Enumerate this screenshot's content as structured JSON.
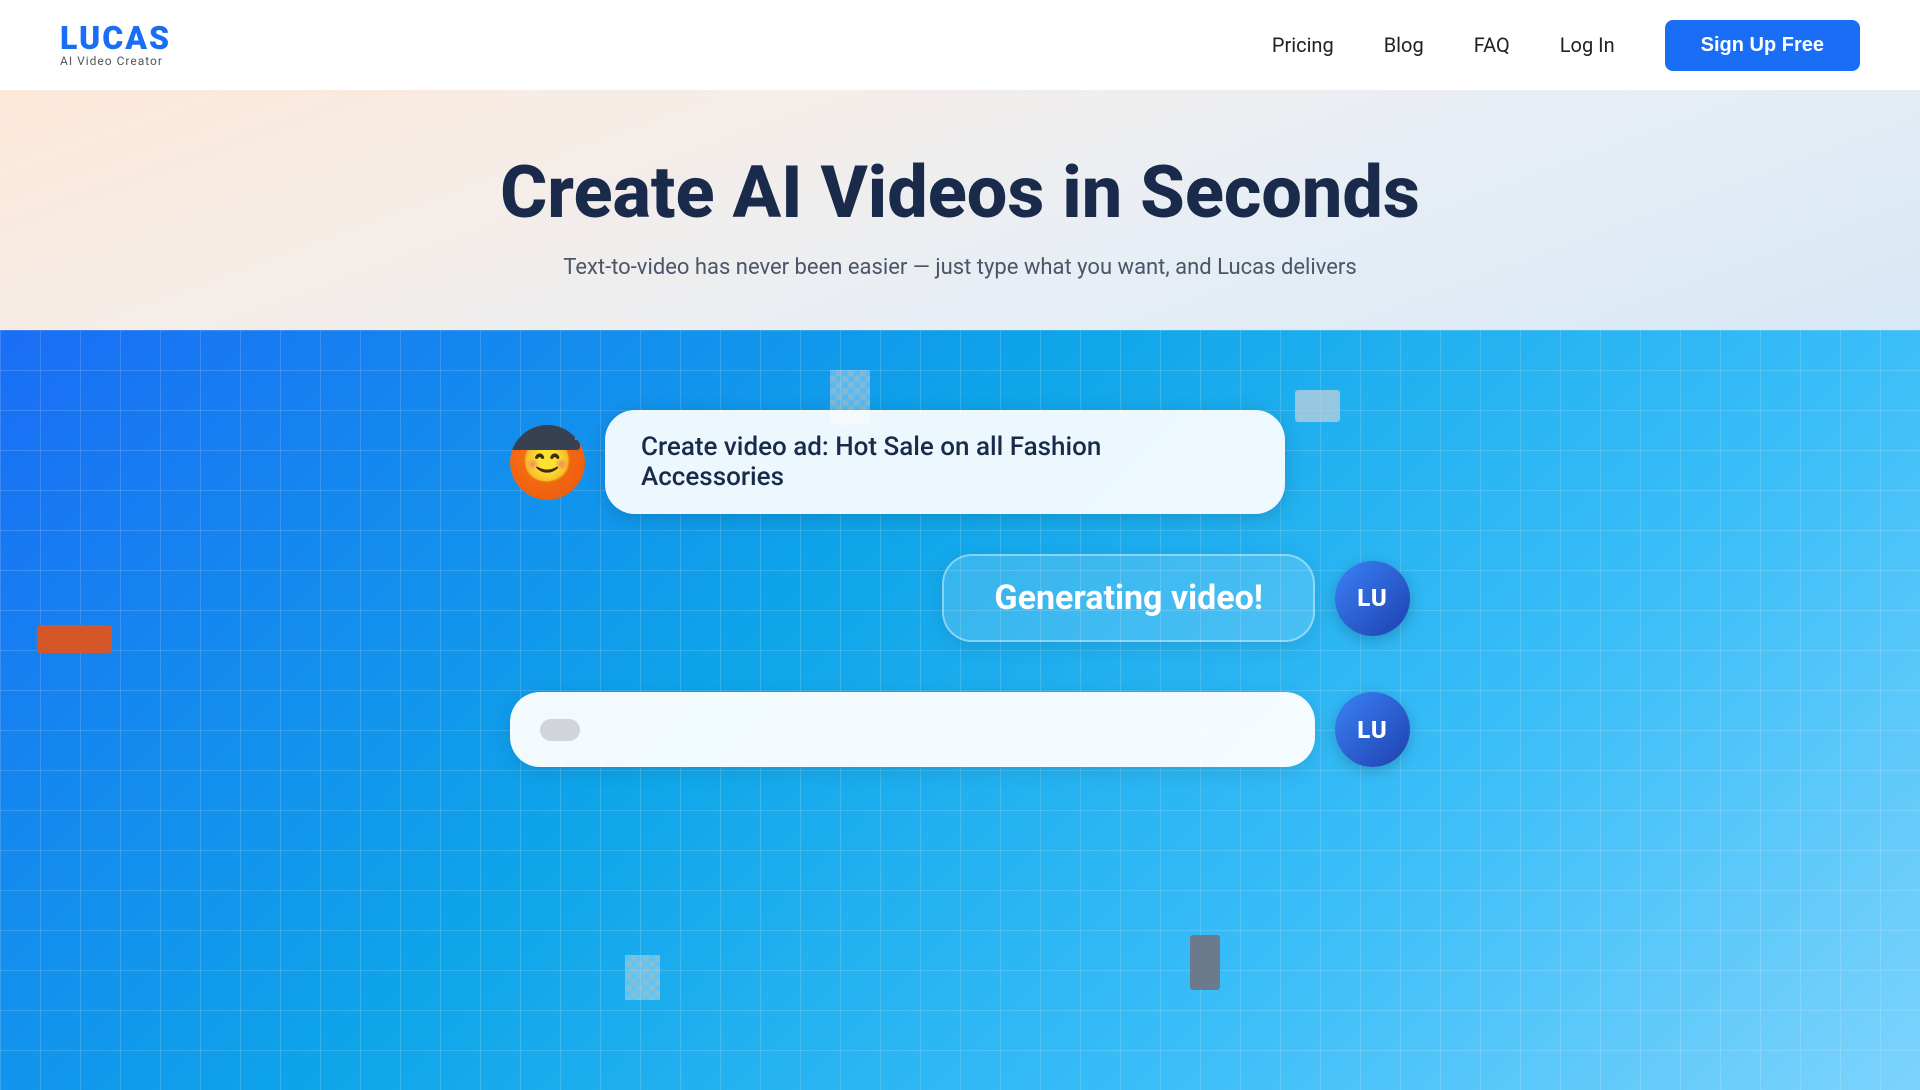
{
  "logo": {
    "text": "LUCAS",
    "subtitle": "AI Video Creator"
  },
  "nav": {
    "links": [
      {
        "label": "Pricing",
        "id": "pricing"
      },
      {
        "label": "Blog",
        "id": "blog"
      },
      {
        "label": "FAQ",
        "id": "faq"
      },
      {
        "label": "Log In",
        "id": "login"
      }
    ],
    "cta": "Sign Up Free"
  },
  "hero": {
    "title": "Create AI Videos in Seconds",
    "subtitle": "Text-to-video has never been easier — just type what you want, and Lucas delivers"
  },
  "chat": {
    "user_message": "Create video ad: Hot Sale on all Fashion Accessories",
    "ai_response": "Generating video!",
    "user_avatar_label": "LU",
    "ai_avatar_label": "LU"
  }
}
